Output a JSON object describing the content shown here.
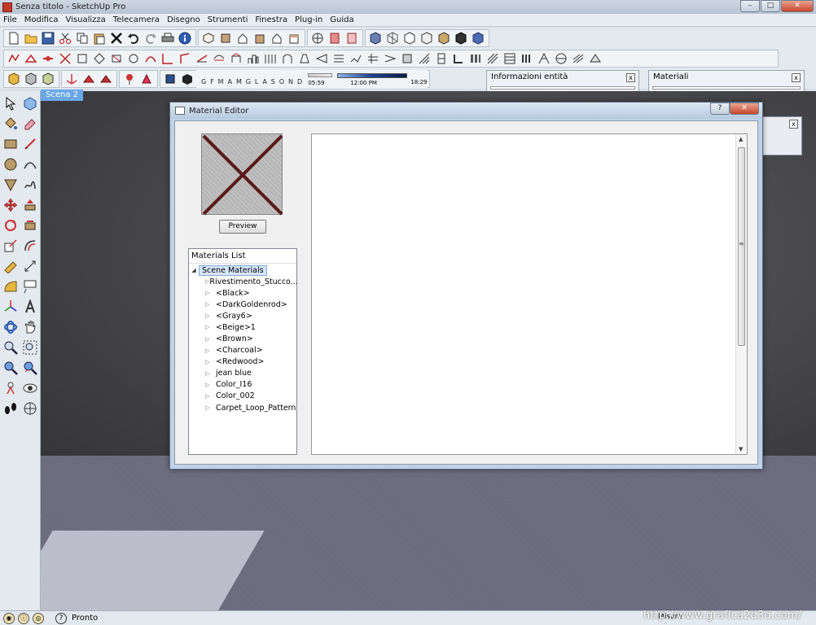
{
  "window": {
    "title": "Senza titolo - SketchUp Pro",
    "minimize": "–",
    "maximize": "□",
    "close": "✕"
  },
  "menu": [
    "File",
    "Modifica",
    "Visualizza",
    "Telecamera",
    "Disegno",
    "Strumenti",
    "Finestra",
    "Plug-in",
    "Guida"
  ],
  "shadow_settings": {
    "months": "G F M A M G L A S O N D",
    "start_time": "05:59",
    "current_time": "12:00 PM",
    "end_time": "18:29"
  },
  "panels": {
    "entity_info": {
      "title": "Informazioni entità",
      "close": "x"
    },
    "materials": {
      "title": "Materiali",
      "close": "x"
    }
  },
  "viewport": {
    "scene_tab": "Scena 2"
  },
  "material_editor": {
    "title": "Material Editor",
    "help_button": "?",
    "close_button": "✕",
    "preview_button": "Preview",
    "list_header": "Materials List",
    "root": "Scene Materials",
    "items": [
      "Rivestimento_Stucco...",
      "<Black>",
      "<DarkGoldenrod>",
      "<Gray6>",
      "<Beige>1",
      "<Brown>",
      "<Charcoal>",
      "<Redwood>",
      "jean blue",
      "Color_I16",
      "Color_002",
      "Carpet_Loop_Pattern"
    ]
  },
  "secondary_dialog": {
    "close": "x"
  },
  "status": {
    "help": "?",
    "text": "Pronto",
    "measure": "Misure"
  },
  "watermark": "http://www.grafica2d3d.com/"
}
